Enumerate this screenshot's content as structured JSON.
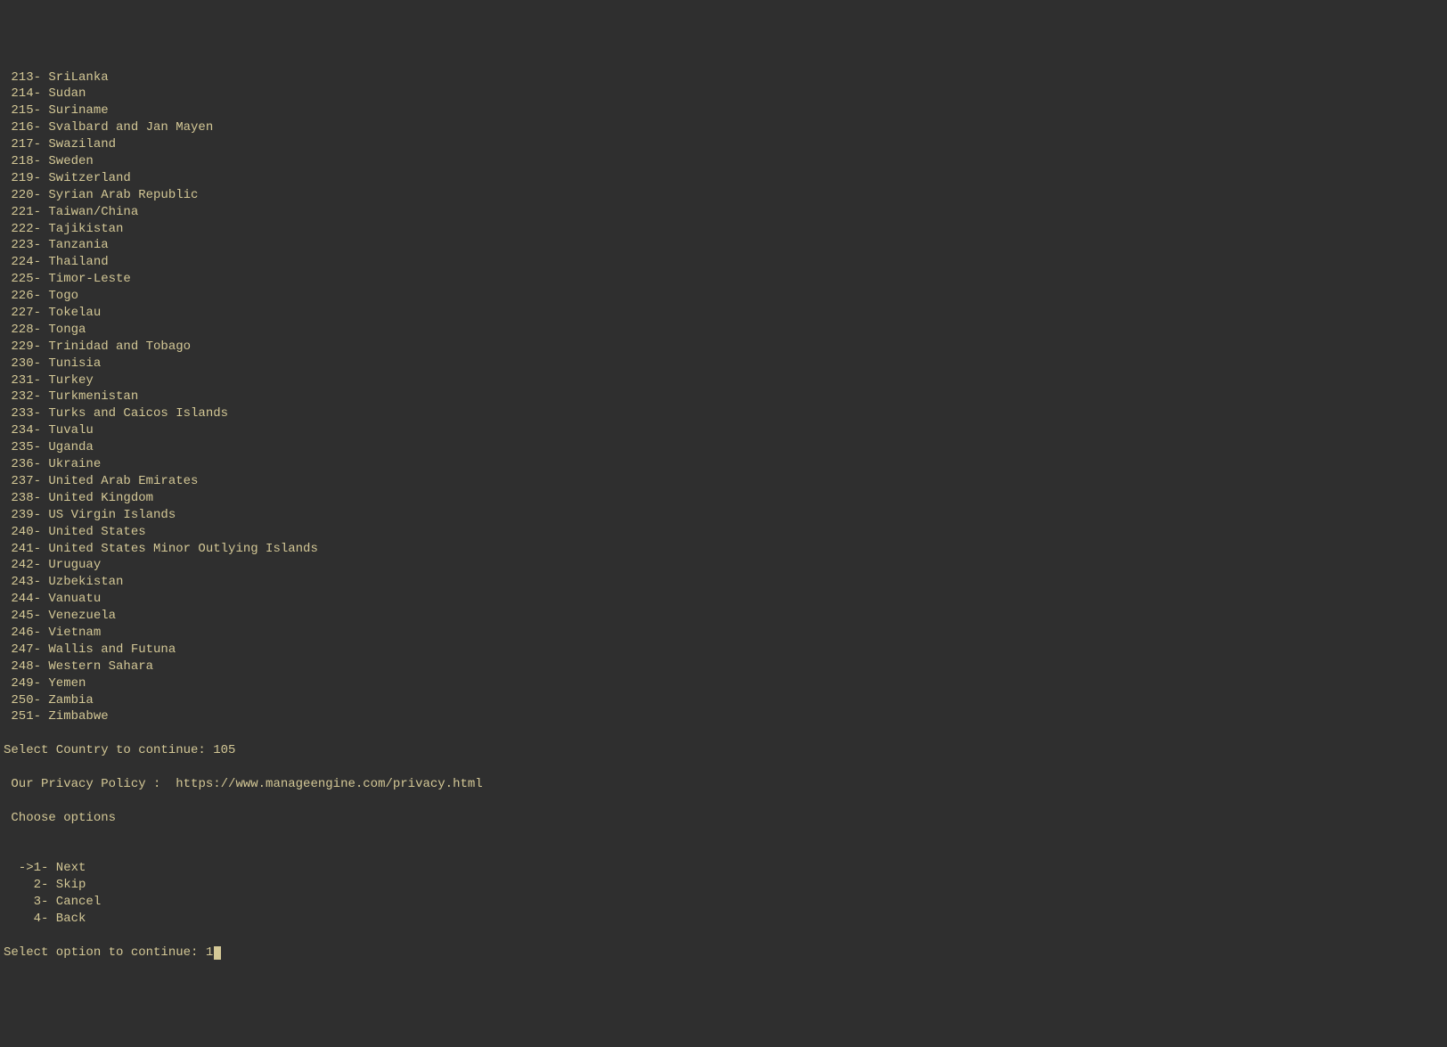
{
  "countries": [
    {
      "num": "213",
      "name": "SriLanka"
    },
    {
      "num": "214",
      "name": "Sudan"
    },
    {
      "num": "215",
      "name": "Suriname"
    },
    {
      "num": "216",
      "name": "Svalbard and Jan Mayen"
    },
    {
      "num": "217",
      "name": "Swaziland"
    },
    {
      "num": "218",
      "name": "Sweden"
    },
    {
      "num": "219",
      "name": "Switzerland"
    },
    {
      "num": "220",
      "name": "Syrian Arab Republic"
    },
    {
      "num": "221",
      "name": "Taiwan/China"
    },
    {
      "num": "222",
      "name": "Tajikistan"
    },
    {
      "num": "223",
      "name": "Tanzania"
    },
    {
      "num": "224",
      "name": "Thailand"
    },
    {
      "num": "225",
      "name": "Timor-Leste"
    },
    {
      "num": "226",
      "name": "Togo"
    },
    {
      "num": "227",
      "name": "Tokelau"
    },
    {
      "num": "228",
      "name": "Tonga"
    },
    {
      "num": "229",
      "name": "Trinidad and Tobago"
    },
    {
      "num": "230",
      "name": "Tunisia"
    },
    {
      "num": "231",
      "name": "Turkey"
    },
    {
      "num": "232",
      "name": "Turkmenistan"
    },
    {
      "num": "233",
      "name": "Turks and Caicos Islands"
    },
    {
      "num": "234",
      "name": "Tuvalu"
    },
    {
      "num": "235",
      "name": "Uganda"
    },
    {
      "num": "236",
      "name": "Ukraine"
    },
    {
      "num": "237",
      "name": "United Arab Emirates"
    },
    {
      "num": "238",
      "name": "United Kingdom"
    },
    {
      "num": "239",
      "name": "US Virgin Islands"
    },
    {
      "num": "240",
      "name": "United States"
    },
    {
      "num": "241",
      "name": "United States Minor Outlying Islands"
    },
    {
      "num": "242",
      "name": "Uruguay"
    },
    {
      "num": "243",
      "name": "Uzbekistan"
    },
    {
      "num": "244",
      "name": "Vanuatu"
    },
    {
      "num": "245",
      "name": "Venezuela"
    },
    {
      "num": "246",
      "name": "Vietnam"
    },
    {
      "num": "247",
      "name": "Wallis and Futuna"
    },
    {
      "num": "248",
      "name": "Western Sahara"
    },
    {
      "num": "249",
      "name": "Yemen"
    },
    {
      "num": "250",
      "name": "Zambia"
    },
    {
      "num": "251",
      "name": "Zimbabwe"
    }
  ],
  "select_country_prompt": "Select Country to continue: ",
  "select_country_value": "105",
  "privacy_label": " Our Privacy Policy :  ",
  "privacy_url": "https://www.manageengine.com/privacy.html",
  "choose_options_label": " Choose options",
  "options": [
    {
      "prefix": "  ->",
      "num": "1",
      "label": "Next"
    },
    {
      "prefix": "    ",
      "num": "2",
      "label": "Skip"
    },
    {
      "prefix": "    ",
      "num": "3",
      "label": "Cancel"
    },
    {
      "prefix": "    ",
      "num": "4",
      "label": "Back"
    }
  ],
  "select_option_prompt": "Select option to continue: ",
  "select_option_value": "1"
}
